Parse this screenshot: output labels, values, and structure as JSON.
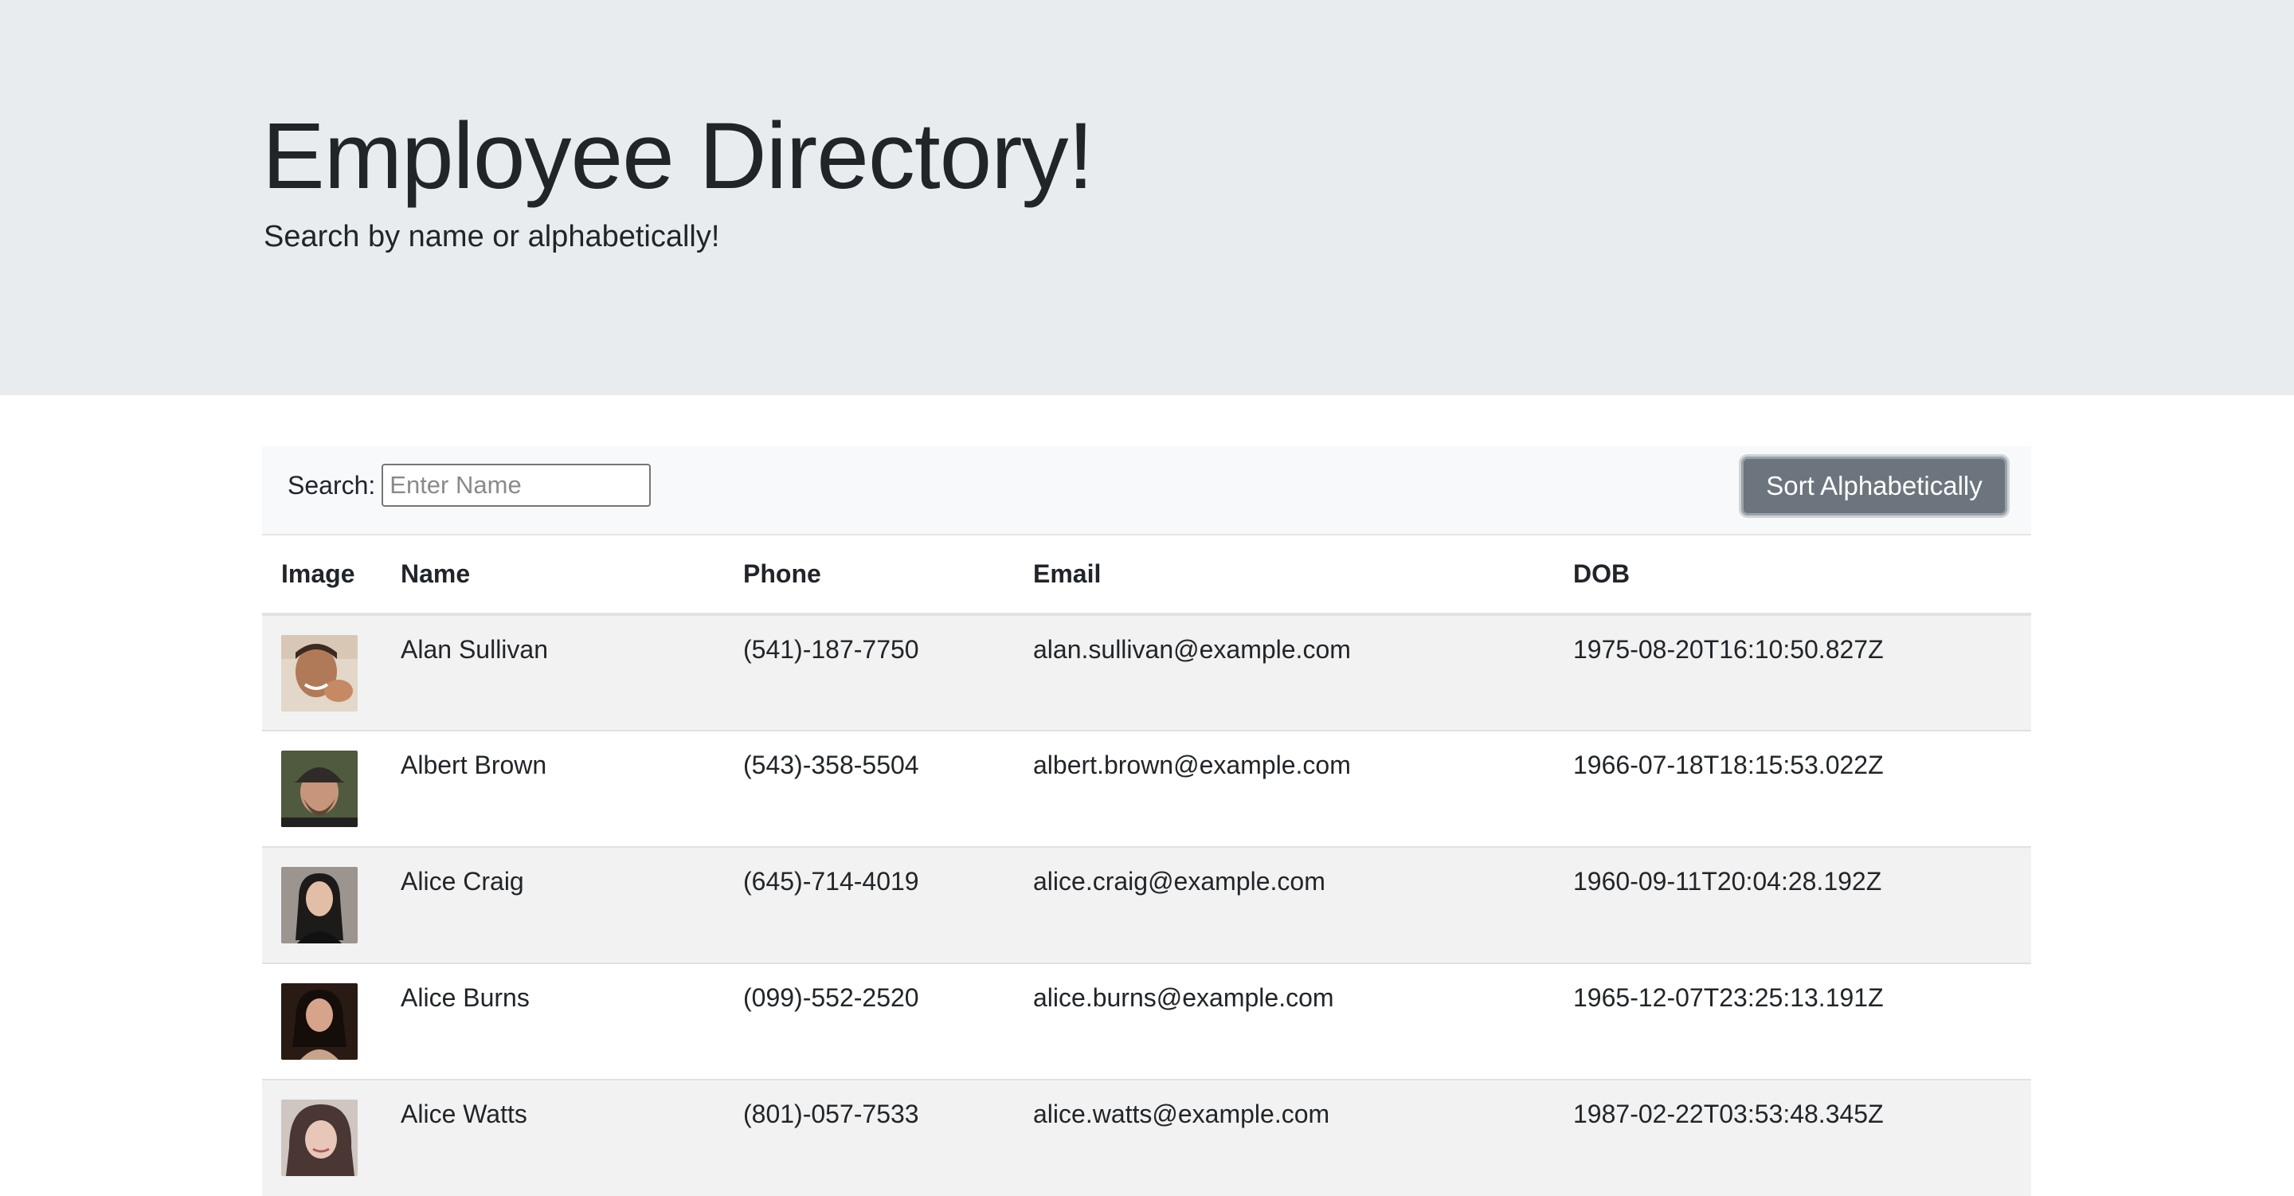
{
  "header": {
    "title": "Employee Directory!",
    "subtitle": "Search by name or alphabetically!"
  },
  "toolbar": {
    "search_label": "Search:",
    "search_placeholder": "Enter Name",
    "search_value": "",
    "sort_label": "Sort Alphabetically"
  },
  "table": {
    "columns": [
      "Image",
      "Name",
      "Phone",
      "Email",
      "DOB"
    ],
    "rows": [
      {
        "name": "Alan Sullivan",
        "phone": "(541)-187-7750",
        "email": "alan.sullivan@example.com",
        "dob": "1975-08-20T16:10:50.827Z"
      },
      {
        "name": "Albert Brown",
        "phone": "(543)-358-5504",
        "email": "albert.brown@example.com",
        "dob": "1966-07-18T18:15:53.022Z"
      },
      {
        "name": "Alice Craig",
        "phone": "(645)-714-4019",
        "email": "alice.craig@example.com",
        "dob": "1960-09-11T20:04:28.192Z"
      },
      {
        "name": "Alice Burns",
        "phone": "(099)-552-2520",
        "email": "alice.burns@example.com",
        "dob": "1965-12-07T23:25:13.191Z"
      },
      {
        "name": "Alice Watts",
        "phone": "(801)-057-7533",
        "email": "alice.watts@example.com",
        "dob": "1987-02-22T03:53:48.345Z"
      }
    ]
  },
  "colors": {
    "jumbotron_bg": "#e9ecef",
    "toolbar_bg": "#f8f9fa",
    "button_bg": "#6c757d",
    "stripe_bg": "#f2f2f2"
  }
}
